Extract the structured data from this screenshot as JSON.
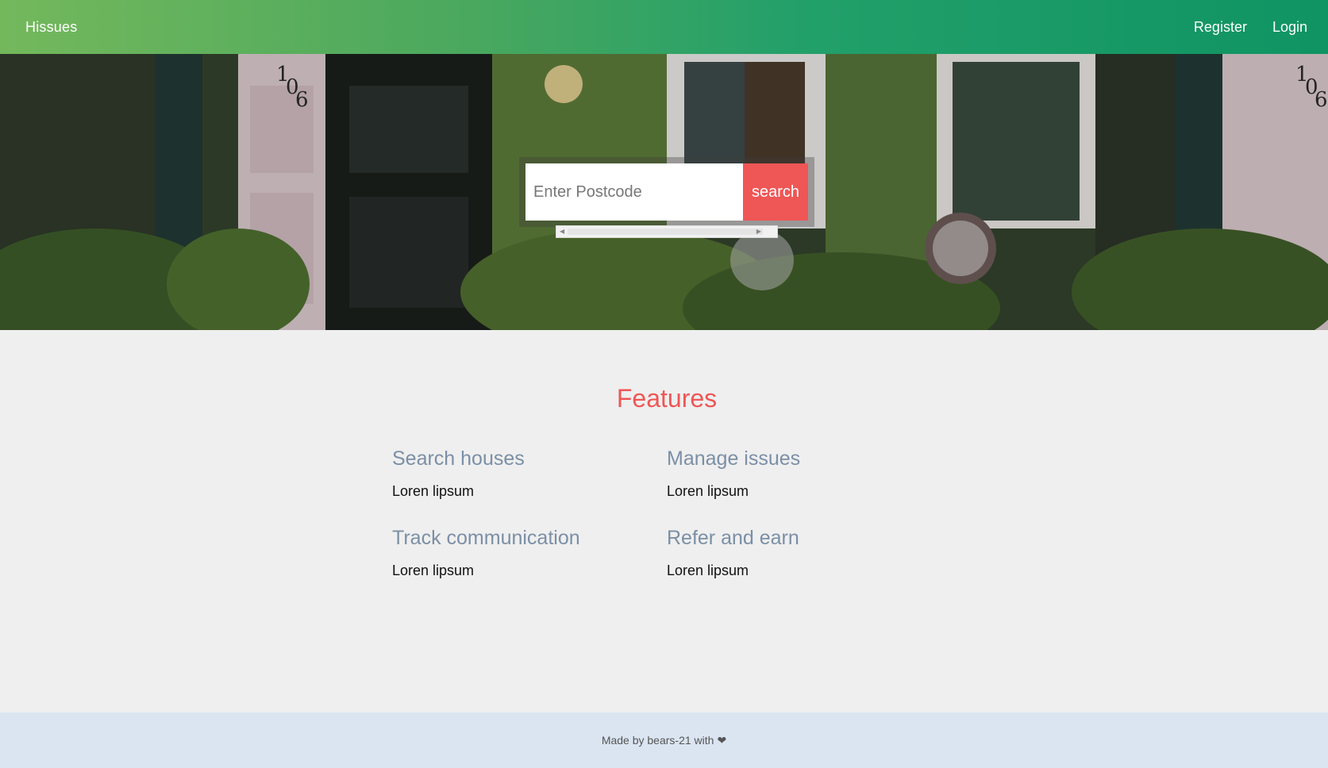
{
  "navbar": {
    "brand": "Hissues",
    "links": [
      {
        "label": "Register"
      },
      {
        "label": "Login"
      }
    ]
  },
  "hero": {
    "search": {
      "placeholder": "Enter Postcode",
      "button_label": "search"
    }
  },
  "features": {
    "title": "Features",
    "items": [
      {
        "heading": "Search houses",
        "text": "Loren lipsum"
      },
      {
        "heading": "Manage issues",
        "text": "Loren lipsum"
      },
      {
        "heading": "Track communication",
        "text": "Loren lipsum"
      },
      {
        "heading": "Refer and earn",
        "text": "Loren lipsum"
      }
    ]
  },
  "footer": {
    "text": "Made by bears-21 with",
    "icon": "heart-icon"
  },
  "colors": {
    "accent": "#ef5656",
    "feature_heading": "#7b8fa6",
    "nav_gradient_start": "#74b85c",
    "nav_gradient_end": "#0f9463",
    "footer_bg": "#dbe5f2"
  }
}
